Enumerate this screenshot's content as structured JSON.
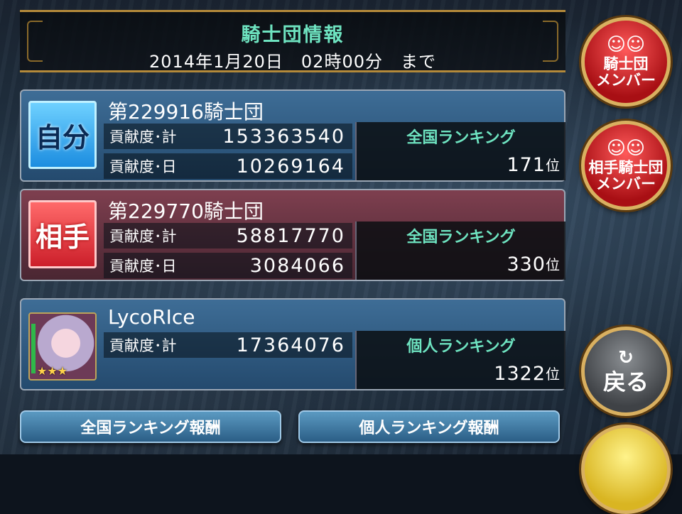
{
  "header": {
    "title": "騎士団情報",
    "deadline": "2014年1月20日　02時00分　まで"
  },
  "self": {
    "badge": "自分",
    "team_name": "第229916騎士団",
    "total_label": "貢献度･計",
    "total_value": "153363540",
    "daily_label": "貢献度･日",
    "daily_value": "10269164",
    "rank_label": "全国ランキング",
    "rank_value": "171",
    "rank_unit": "位"
  },
  "opponent": {
    "badge": "相手",
    "team_name": "第229770騎士団",
    "total_label": "貢献度･計",
    "total_value": "58817770",
    "daily_label": "貢献度･日",
    "daily_value": "3084066",
    "rank_label": "全国ランキング",
    "rank_value": "330",
    "rank_unit": "位"
  },
  "user": {
    "name": "LycoRIce",
    "total_label": "貢献度･計",
    "total_value": "17364076",
    "rank_label": "個人ランキング",
    "rank_value": "1322",
    "rank_unit": "位",
    "stars": "★★★"
  },
  "side_buttons": {
    "members_line1": "騎士団",
    "members_line2": "メンバー",
    "opp_members_line1": "相手騎士団",
    "opp_members_line2": "メンバー",
    "back": "戻る"
  },
  "bottom_buttons": {
    "national_reward": "全国ランキング報酬",
    "personal_reward": "個人ランキング報酬"
  },
  "colors": {
    "accent_teal": "#6ee3c0",
    "gold_border": "#b48a3a",
    "side_button_red": "#c8161d",
    "bottom_button_blue": "#3c7ba6"
  }
}
